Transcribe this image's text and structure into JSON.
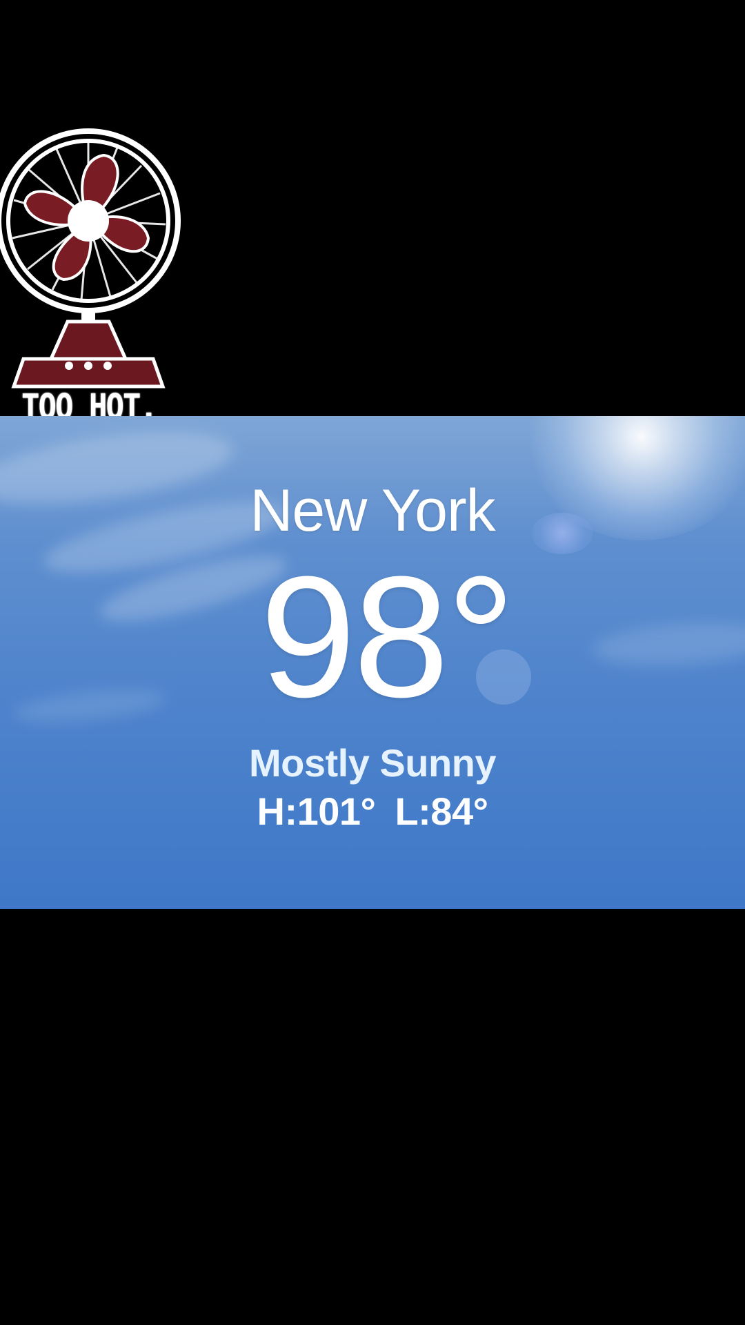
{
  "sticker": {
    "caption": "TOO HOT.",
    "icon": "fan-icon",
    "colors": {
      "blade": "#7a1c24",
      "outline": "#ffffff",
      "base": "#6b1820"
    }
  },
  "weather": {
    "city": "New York",
    "temperature": "98°",
    "condition": "Mostly Sunny",
    "high": "H:101°",
    "low": "L:84°",
    "colors": {
      "sky": "#4f84cc",
      "text": "#ffffff"
    }
  }
}
